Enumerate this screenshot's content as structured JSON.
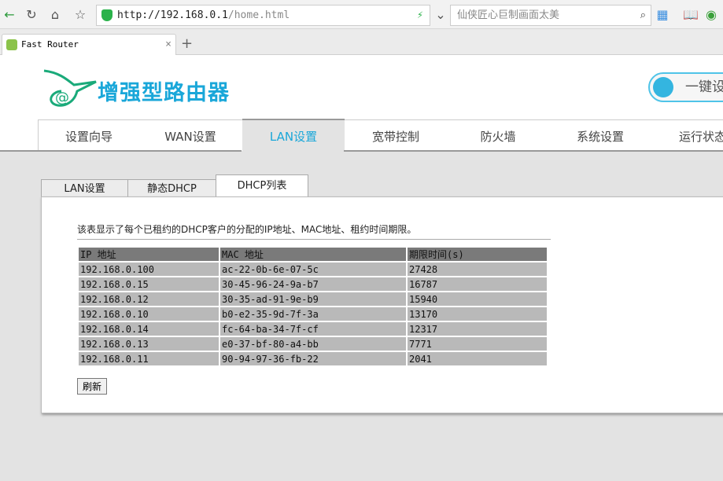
{
  "browser": {
    "url_host": "http://192.168.0.1",
    "url_path": "/home.html",
    "search_placeholder": "仙侠匠心巨制画面太美",
    "tab_title": "Fast Router"
  },
  "header": {
    "logo_text": "增强型路由器",
    "onekey_label": "一键设"
  },
  "nav": {
    "items": [
      {
        "label": "设置向导"
      },
      {
        "label": "WAN设置"
      },
      {
        "label": "LAN设置"
      },
      {
        "label": "宽带控制"
      },
      {
        "label": "防火墙"
      },
      {
        "label": "系统设置"
      },
      {
        "label": "运行状态"
      }
    ],
    "active": "LAN设置"
  },
  "subtabs": {
    "items": [
      {
        "label": "LAN设置"
      },
      {
        "label": "静态DHCP"
      },
      {
        "label": "DHCP列表"
      }
    ],
    "active": "DHCP列表"
  },
  "content": {
    "description": "该表显示了每个已租约的DHCP客户的分配的IP地址、MAC地址、租约时间期限。",
    "columns": [
      "IP 地址",
      "MAC 地址",
      "期限时间(s)"
    ],
    "rows": [
      [
        "192.168.0.100",
        "ac-22-0b-6e-07-5c",
        "27428"
      ],
      [
        "192.168.0.15",
        "30-45-96-24-9a-b7",
        "16787"
      ],
      [
        "192.168.0.12",
        "30-35-ad-91-9e-b9",
        "15940"
      ],
      [
        "192.168.0.10",
        "b0-e2-35-9d-7f-3a",
        "13170"
      ],
      [
        "192.168.0.14",
        "fc-64-ba-34-7f-cf",
        "12317"
      ],
      [
        "192.168.0.13",
        "e0-37-bf-80-a4-bb",
        "7771"
      ],
      [
        "192.168.0.11",
        "90-94-97-36-fb-22",
        "2041"
      ]
    ],
    "refresh_label": "刷新"
  },
  "colors": {
    "accent": "#1aa7d9",
    "logo_green": "#1aaa7a"
  }
}
